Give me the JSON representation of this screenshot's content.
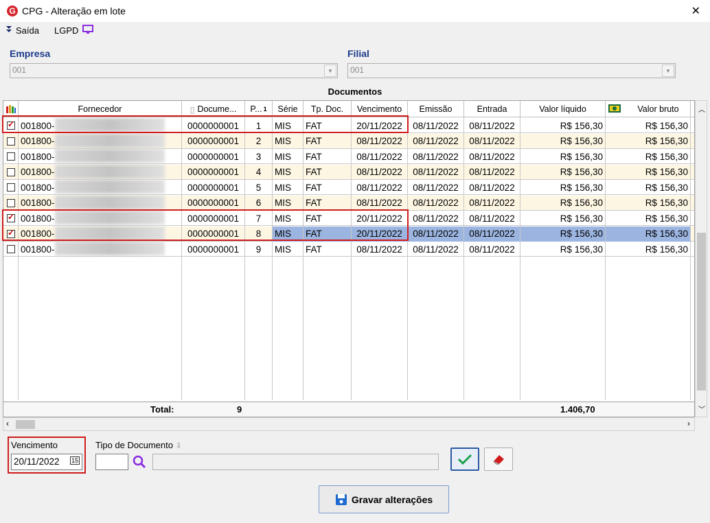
{
  "window": {
    "title": "CPG - Alteração em lote",
    "close_label": "✕"
  },
  "toolbar": {
    "exit_label": "Saída",
    "lgpd_label": "LGPD"
  },
  "filters": {
    "empresa_label": "Empresa",
    "empresa_value": "001",
    "filial_label": "Filial",
    "filial_value": "001"
  },
  "grid": {
    "title": "Documentos",
    "headers": {
      "fornecedor": "Fornecedor",
      "documento": "Docume...",
      "parcela": "P...",
      "serie": "Série",
      "tipo": "Tp. Doc.",
      "vencimento": "Vencimento",
      "emissao": "Emissão",
      "entrada": "Entrada",
      "valor_liquido": "Valor líquido",
      "valor_bruto": "Valor bruto"
    },
    "rows": [
      {
        "checked": true,
        "fornecedor": "001800-",
        "documento": "0000000001",
        "parcela": "1",
        "serie": "MIS",
        "tipo": "FAT",
        "vencimento": "20/11/2022",
        "emissao": "08/11/2022",
        "entrada": "08/11/2022",
        "valor_liquido": "R$ 156,30",
        "valor_bruto": "R$ 156,30"
      },
      {
        "checked": false,
        "fornecedor": "001800-",
        "documento": "0000000001",
        "parcela": "2",
        "serie": "MIS",
        "tipo": "FAT",
        "vencimento": "08/11/2022",
        "emissao": "08/11/2022",
        "entrada": "08/11/2022",
        "valor_liquido": "R$ 156,30",
        "valor_bruto": "R$ 156,30"
      },
      {
        "checked": false,
        "fornecedor": "001800-",
        "documento": "0000000001",
        "parcela": "3",
        "serie": "MIS",
        "tipo": "FAT",
        "vencimento": "08/11/2022",
        "emissao": "08/11/2022",
        "entrada": "08/11/2022",
        "valor_liquido": "R$ 156,30",
        "valor_bruto": "R$ 156,30"
      },
      {
        "checked": false,
        "fornecedor": "001800-",
        "documento": "0000000001",
        "parcela": "4",
        "serie": "MIS",
        "tipo": "FAT",
        "vencimento": "08/11/2022",
        "emissao": "08/11/2022",
        "entrada": "08/11/2022",
        "valor_liquido": "R$ 156,30",
        "valor_bruto": "R$ 156,30"
      },
      {
        "checked": false,
        "fornecedor": "001800-",
        "documento": "0000000001",
        "parcela": "5",
        "serie": "MIS",
        "tipo": "FAT",
        "vencimento": "08/11/2022",
        "emissao": "08/11/2022",
        "entrada": "08/11/2022",
        "valor_liquido": "R$ 156,30",
        "valor_bruto": "R$ 156,30"
      },
      {
        "checked": false,
        "fornecedor": "001800-",
        "documento": "0000000001",
        "parcela": "6",
        "serie": "MIS",
        "tipo": "FAT",
        "vencimento": "08/11/2022",
        "emissao": "08/11/2022",
        "entrada": "08/11/2022",
        "valor_liquido": "R$ 156,30",
        "valor_bruto": "R$ 156,30"
      },
      {
        "checked": true,
        "fornecedor": "001800-",
        "documento": "0000000001",
        "parcela": "7",
        "serie": "MIS",
        "tipo": "FAT",
        "vencimento": "20/11/2022",
        "emissao": "08/11/2022",
        "entrada": "08/11/2022",
        "valor_liquido": "R$ 156,30",
        "valor_bruto": "R$ 156,30"
      },
      {
        "checked": true,
        "fornecedor": "001800-",
        "documento": "0000000001",
        "parcela": "8",
        "serie": "MIS",
        "tipo": "FAT",
        "vencimento": "20/11/2022",
        "emissao": "08/11/2022",
        "entrada": "08/11/2022",
        "valor_liquido": "R$ 156,30",
        "valor_bruto": "R$ 156,30"
      },
      {
        "checked": false,
        "fornecedor": "001800-",
        "documento": "0000000001",
        "parcela": "9",
        "serie": "MIS",
        "tipo": "FAT",
        "vencimento": "08/11/2022",
        "emissao": "08/11/2022",
        "entrada": "08/11/2022",
        "valor_liquido": "R$ 156,30",
        "valor_bruto": "R$ 156,30"
      }
    ],
    "totals": {
      "label": "Total:",
      "count": "9",
      "valor_liquido": "1.406,70"
    }
  },
  "form": {
    "vencimento_label": "Vencimento",
    "vencimento_value": "20/11/2022",
    "tipo_doc_label": "Tipo de Documento",
    "tipo_doc_value": "",
    "tipo_doc_desc": ""
  },
  "actions": {
    "save_label": "Gravar alterações"
  },
  "colors": {
    "highlight_red": "#d01c1c",
    "selected_row": "#9bb4e0",
    "alt_row": "#fdf6e3",
    "label_blue": "#1a3a8a"
  }
}
